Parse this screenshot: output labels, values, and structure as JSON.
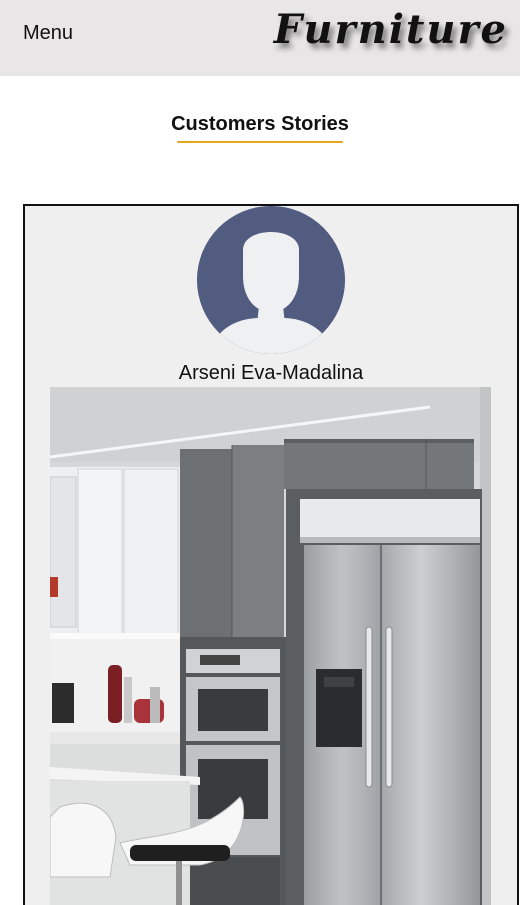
{
  "header": {
    "menu_label": "Menu",
    "logo_text": "Furniture"
  },
  "section": {
    "title": "Customers Stories",
    "underline_color": "#e4a71f"
  },
  "stories": [
    {
      "customer_name": "Arseni Eva-Madalina",
      "avatar_icon": "user-silhouette-icon",
      "photo_subject": "kitchen-photo"
    }
  ],
  "colors": {
    "header_bg": "#e8e6e6",
    "card_bg": "#efefef",
    "avatar_bg": "#525c80"
  }
}
